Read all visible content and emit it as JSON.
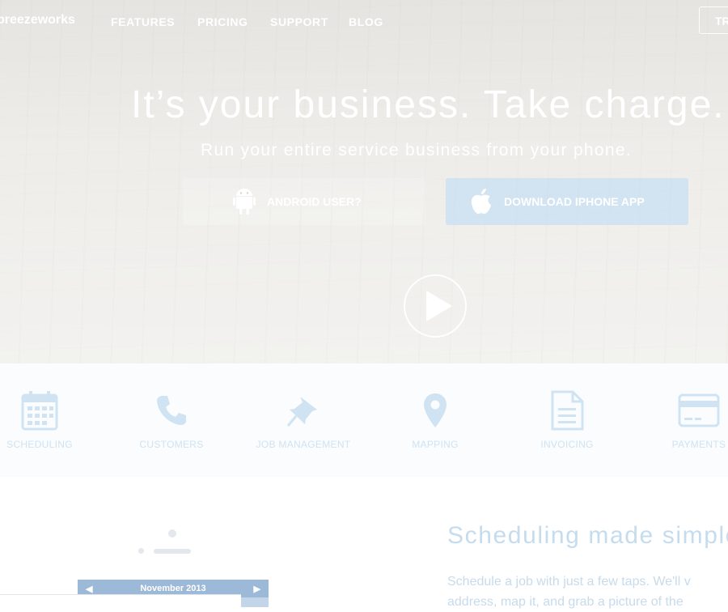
{
  "nav": {
    "logo": "breezeworks",
    "links": [
      "FEATURES",
      "PRICING",
      "SUPPORT",
      "BLOG"
    ],
    "try_button": "TR"
  },
  "hero": {
    "headline": "It’s your business. Take charge.",
    "subheadline": "Run your entire service business from your phone.",
    "android_button": "ANDROID USER?",
    "iphone_button": "DOWNLOAD IPHONE APP",
    "play_icon": "play-icon"
  },
  "features": [
    {
      "label": "SCHEDULING",
      "icon": "calendar-icon"
    },
    {
      "label": "CUSTOMERS",
      "icon": "phone-icon"
    },
    {
      "label": "JOB MANAGEMENT",
      "icon": "pin-icon"
    },
    {
      "label": "MAPPING",
      "icon": "map-marker-icon"
    },
    {
      "label": "INVOICING",
      "icon": "document-icon"
    },
    {
      "label": "PAYMENTS",
      "icon": "credit-card-icon"
    }
  ],
  "section": {
    "title": "Scheduling made simple",
    "text_line1": "Schedule a job with just a few taps. We'll v",
    "text_line2": "address, map it, and grab a picture of the"
  },
  "calendar": {
    "month": "November 2013"
  },
  "colors": {
    "accent": "#c5dcee",
    "hero_overlay": "#ffffff"
  }
}
